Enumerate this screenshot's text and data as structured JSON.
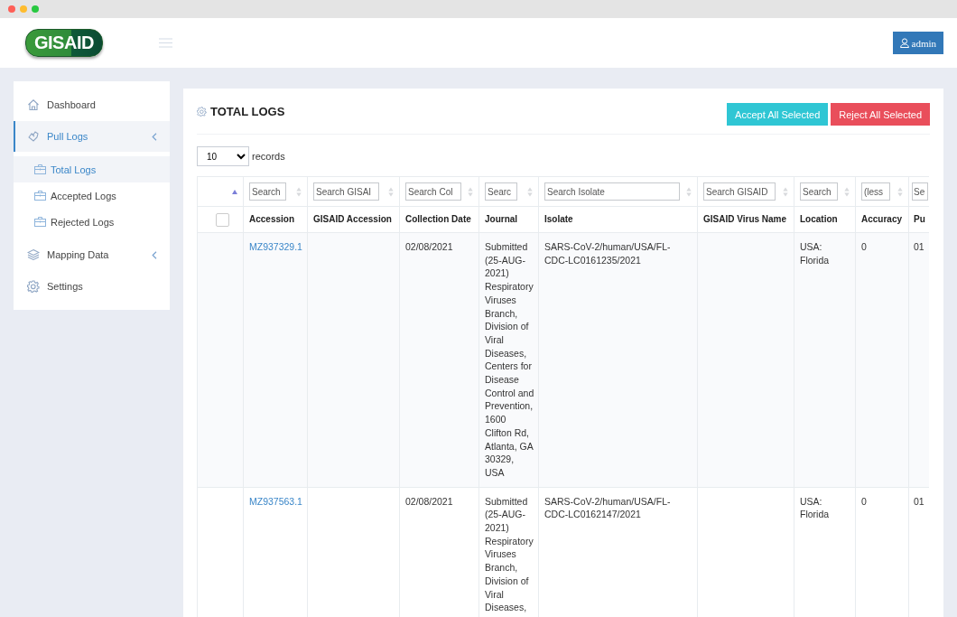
{
  "header": {
    "logo": "GISAID",
    "user_button": "admin"
  },
  "sidebar": {
    "items": [
      {
        "label": "Dashboard",
        "kind": "link",
        "selected": false
      },
      {
        "label": "Pull Logs",
        "kind": "group",
        "selected": true,
        "children": [
          {
            "label": "Total Logs",
            "selected": true
          },
          {
            "label": "Accepted Logs",
            "selected": false
          },
          {
            "label": "Rejected Logs",
            "selected": false
          }
        ]
      },
      {
        "label": "Mapping Data",
        "kind": "group",
        "selected": false
      },
      {
        "label": "Settings",
        "kind": "link",
        "selected": false
      }
    ]
  },
  "panel": {
    "title": "TOTAL LOGS",
    "buttons": [
      {
        "label": "Accept All Selected",
        "kind": "accept"
      },
      {
        "label": "Reject All Selected",
        "kind": "reject"
      }
    ],
    "page_size": {
      "value": "10",
      "label": "records"
    }
  },
  "table": {
    "select_all": {
      "checked": false
    },
    "columns": [
      {
        "header": "Accession",
        "placeholder": "Search"
      },
      {
        "header": "GISAID Accession",
        "placeholder": "Search GISAI"
      },
      {
        "header": "Collection Date",
        "placeholder": "Search Col"
      },
      {
        "header": "Journal",
        "placeholder": "Searc"
      },
      {
        "header": "Isolate",
        "placeholder": "Search Isolate"
      },
      {
        "header": "GISAID Virus Name",
        "placeholder": "Search GISAID"
      },
      {
        "header": "Location",
        "placeholder": "Search"
      },
      {
        "header": "Accuracy",
        "placeholder": "(less"
      },
      {
        "header": "Pu",
        "placeholder": "Se"
      }
    ],
    "rows": [
      {
        "cells": [
          "MZ937329.1",
          "",
          "02/08/2021",
          "Submitted (25-AUG-2021) Respiratory Viruses Branch, Division of Viral Diseases, Centers for Disease Control and Prevention, 1600 Clifton Rd, Atlanta, GA 30329, USA",
          "SARS-CoV-2/human/USA/FL-CDC-LC0161235/2021",
          "",
          "USA: Florida",
          "0",
          "01"
        ]
      },
      {
        "cells": [
          "MZ937563.1",
          "",
          "02/08/2021",
          "Submitted (25-AUG-2021) Respiratory Viruses Branch, Division of Viral Diseases,",
          "SARS-CoV-2/human/USA/FL-CDC-LC0162147/2021",
          "",
          "USA: Florida",
          "0",
          "01"
        ]
      }
    ]
  }
}
